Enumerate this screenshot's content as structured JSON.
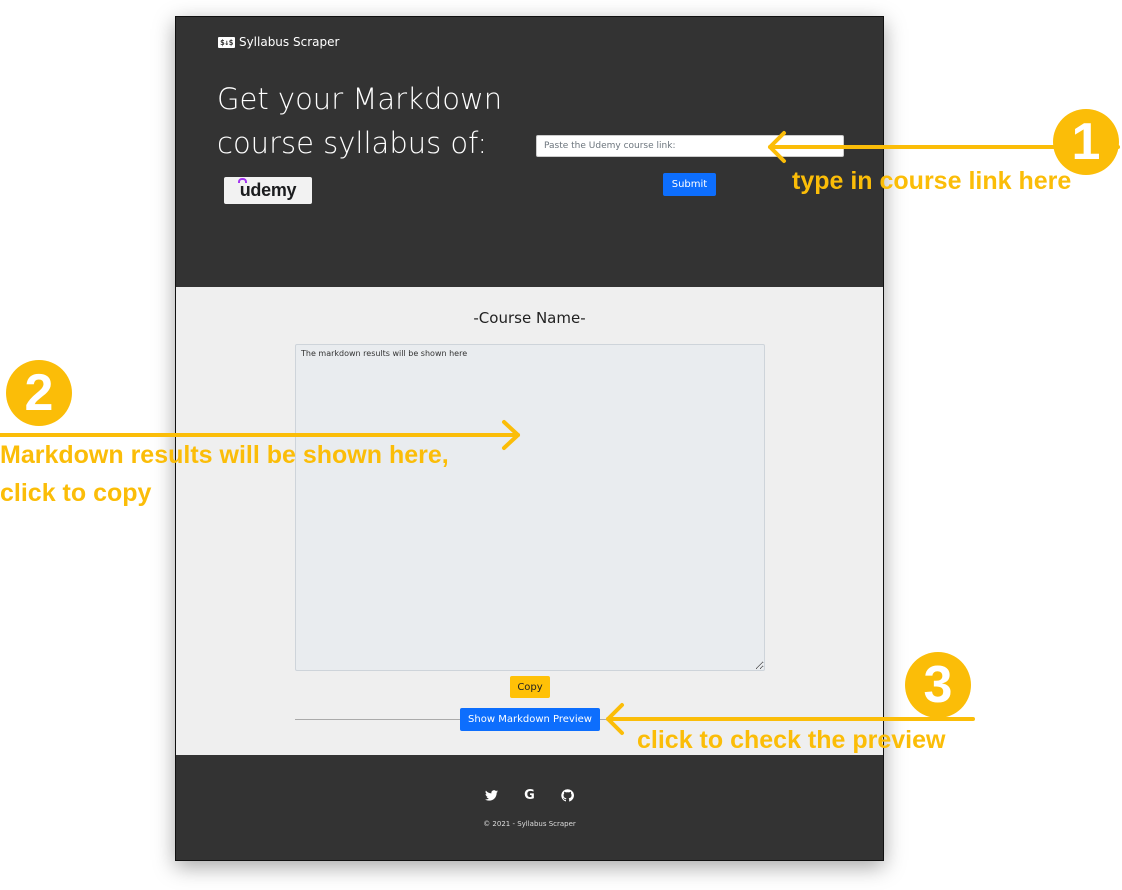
{
  "header": {
    "brand_logo": "$↓$",
    "brand_name": "Syllabus Scraper",
    "headline": "Get your Markdown course syllabus of:",
    "platform_logo": "udemy",
    "url_placeholder": "Paste the Udemy course link:",
    "submit_label": "Submit"
  },
  "main": {
    "course_name": "-Course Name-",
    "markdown_placeholder": "The markdown results will be shown here",
    "copy_label": "Copy",
    "preview_label": "Show Markdown Preview"
  },
  "footer": {
    "social_icons": [
      "twitter-icon",
      "google-icon",
      "github-icon"
    ],
    "twitter_glyph": "🐦",
    "google_glyph": "G",
    "github_glyph": "◖",
    "copyright": "© 2021 - Syllabus Scraper"
  },
  "annotations": {
    "step1": {
      "number": "1",
      "text": "type in course link here"
    },
    "step2": {
      "number": "2",
      "text_line1": "Markdown results will be shown here,",
      "text_line2": "click to copy"
    },
    "step3": {
      "number": "3",
      "text": "click to check the preview"
    },
    "accent_color": "#fbbd08"
  },
  "colors": {
    "dark_bg": "#333333",
    "light_bg": "#efefef",
    "primary": "#0d6efd",
    "warning": "#ffc107"
  }
}
